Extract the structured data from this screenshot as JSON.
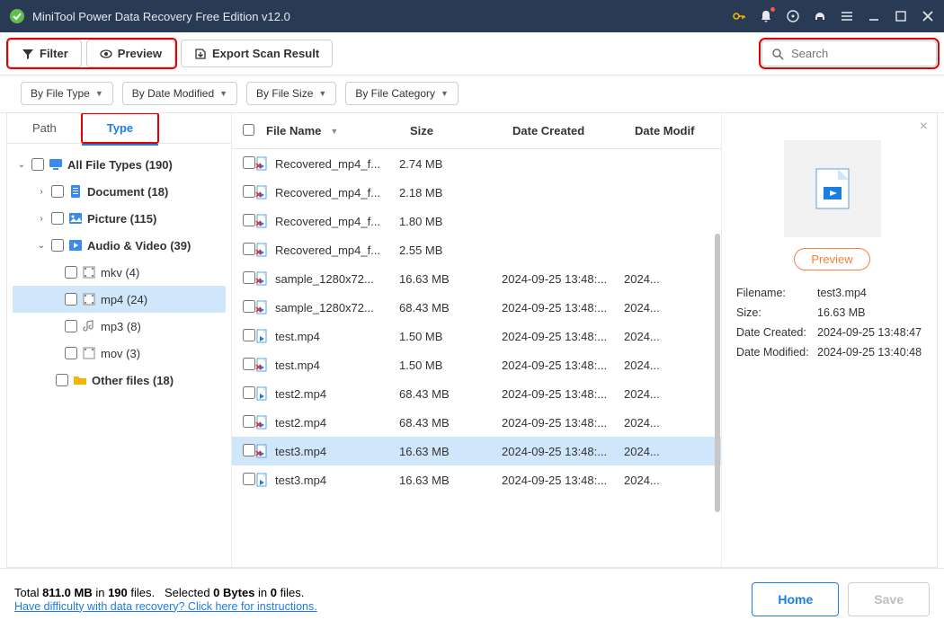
{
  "titlebar": {
    "title": "MiniTool Power Data Recovery Free Edition v12.0"
  },
  "toolbar": {
    "filter": "Filter",
    "preview": "Preview",
    "export": "Export Scan Result",
    "search_placeholder": "Search"
  },
  "filters": {
    "by_type": "By File Type",
    "by_date": "By Date Modified",
    "by_size": "By File Size",
    "by_cat": "By File Category"
  },
  "tabs": {
    "path": "Path",
    "type": "Type"
  },
  "tree": {
    "all": "All File Types (190)",
    "doc": "Document (18)",
    "pic": "Picture (115)",
    "av": "Audio & Video (39)",
    "mkv": "mkv (4)",
    "mp4": "mp4 (24)",
    "mp3": "mp3 (8)",
    "mov": "mov (3)",
    "other": "Other files (18)"
  },
  "columns": {
    "name": "File Name",
    "size": "Size",
    "date": "Date Created",
    "mod": "Date Modif"
  },
  "files": [
    {
      "name": "Recovered_mp4_f...",
      "size": "2.74 MB",
      "date": "",
      "mod": "",
      "deleted": true
    },
    {
      "name": "Recovered_mp4_f...",
      "size": "2.18 MB",
      "date": "",
      "mod": "",
      "deleted": true
    },
    {
      "name": "Recovered_mp4_f...",
      "size": "1.80 MB",
      "date": "",
      "mod": "",
      "deleted": true
    },
    {
      "name": "Recovered_mp4_f...",
      "size": "2.55 MB",
      "date": "",
      "mod": "",
      "deleted": true
    },
    {
      "name": "sample_1280x72...",
      "size": "16.63 MB",
      "date": "2024-09-25 13:48:...",
      "mod": "2024...",
      "deleted": true
    },
    {
      "name": "sample_1280x72...",
      "size": "68.43 MB",
      "date": "2024-09-25 13:48:...",
      "mod": "2024...",
      "deleted": true
    },
    {
      "name": "test.mp4",
      "size": "1.50 MB",
      "date": "2024-09-25 13:48:...",
      "mod": "2024...",
      "deleted": false
    },
    {
      "name": "test.mp4",
      "size": "1.50 MB",
      "date": "2024-09-25 13:48:...",
      "mod": "2024...",
      "deleted": true
    },
    {
      "name": "test2.mp4",
      "size": "68.43 MB",
      "date": "2024-09-25 13:48:...",
      "mod": "2024...",
      "deleted": false
    },
    {
      "name": "test2.mp4",
      "size": "68.43 MB",
      "date": "2024-09-25 13:48:...",
      "mod": "2024...",
      "deleted": true
    },
    {
      "name": "test3.mp4",
      "size": "16.63 MB",
      "date": "2024-09-25 13:48:...",
      "mod": "2024...",
      "deleted": true,
      "selected": true
    },
    {
      "name": "test3.mp4",
      "size": "16.63 MB",
      "date": "2024-09-25 13:48:...",
      "mod": "2024...",
      "deleted": false
    }
  ],
  "preview": {
    "button": "Preview",
    "filename_k": "Filename:",
    "filename_v": "test3.mp4",
    "size_k": "Size:",
    "size_v": "16.63 MB",
    "created_k": "Date Created:",
    "created_v": "2024-09-25 13:48:47",
    "modified_k": "Date Modified:",
    "modified_v": "2024-09-25 13:40:48"
  },
  "footer": {
    "total_a": "Total ",
    "total_b": "811.0 MB",
    "total_c": " in ",
    "total_d": "190",
    "total_e": " files.",
    "sel_a": "Selected ",
    "sel_b": "0 Bytes",
    "sel_c": " in ",
    "sel_d": "0",
    "sel_e": " files.",
    "help": "Have difficulty with data recovery? Click here for instructions.",
    "home": "Home",
    "save": "Save"
  }
}
